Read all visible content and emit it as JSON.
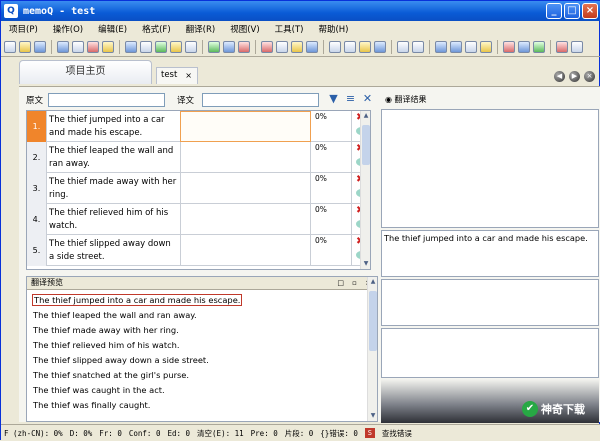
{
  "window": {
    "title": "memoQ - test",
    "min": "_",
    "max": "□",
    "close": "×"
  },
  "menu": [
    "项目(P)",
    "操作(O)",
    "编辑(E)",
    "格式(F)",
    "翻译(R)",
    "视图(V)",
    "工具(T)",
    "帮助(H)"
  ],
  "tabs": {
    "home": "项目主页",
    "doc": "test",
    "doc_close": "×"
  },
  "filter": {
    "source_label": "原文",
    "target_label": "译文",
    "source_value": "",
    "target_value": ""
  },
  "grid": {
    "rows": [
      {
        "num": "1.",
        "source": "The thief jumped into a car and made his escape.",
        "target": "",
        "pct": "0%"
      },
      {
        "num": "2.",
        "source": "The thief leaped the wall and ran away.",
        "target": "",
        "pct": "0%"
      },
      {
        "num": "3.",
        "source": "The thief made away with her ring.",
        "target": "",
        "pct": "0%"
      },
      {
        "num": "4.",
        "source": "The thief relieved him of his watch.",
        "target": "",
        "pct": "0%"
      },
      {
        "num": "5.",
        "source": "The thief slipped away down a side street.",
        "target": "",
        "pct": "0%"
      }
    ]
  },
  "preview": {
    "title": "翻译预览",
    "lines": [
      "The thief jumped into a car and made his escape.",
      "The thief leaped the wall and ran away.",
      "The thief made away with her ring.",
      "The thief relieved him of his watch.",
      "The thief slipped away down a side street.",
      "The thief snatched at the girl's purse.",
      "The thief was caught in the act.",
      "The thief was finally caught."
    ]
  },
  "results": {
    "title": "翻译结果",
    "source_text": "The thief jumped into a car and made his escape."
  },
  "status": {
    "items": [
      "F (zh-CN): 0%",
      "D: 0%",
      "Fr: 0",
      "Conf: 0",
      "Ed: 0",
      "清空(E): 11",
      "Pre: 0",
      "片段: 0",
      "{}错误: 0"
    ],
    "search": "查找错误"
  },
  "watermark": {
    "text": "神奇下载"
  }
}
